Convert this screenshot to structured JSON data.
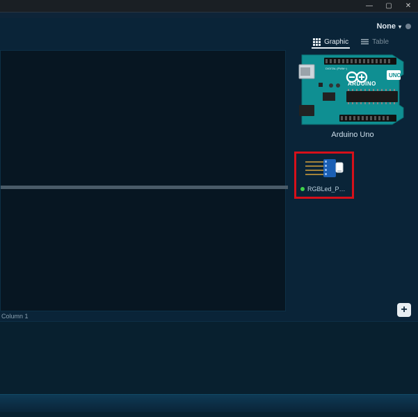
{
  "window": {
    "minimize_glyph": "—",
    "maximize_glyph": "▢",
    "close_glyph": "✕"
  },
  "toolbar": {
    "dropdown_label": "None",
    "view_graphic_label": "Graphic",
    "view_table_label": "Table"
  },
  "preview": {
    "board_name": "Arduino Uno"
  },
  "component": {
    "label": "RGBLed_P…"
  },
  "status": {
    "column_label": "Column 1"
  },
  "actions": {
    "add_glyph": "+"
  },
  "colors": {
    "highlight_red": "#d6101a",
    "teal": "#0f8f92",
    "teal_dark": "#0b6e71"
  }
}
